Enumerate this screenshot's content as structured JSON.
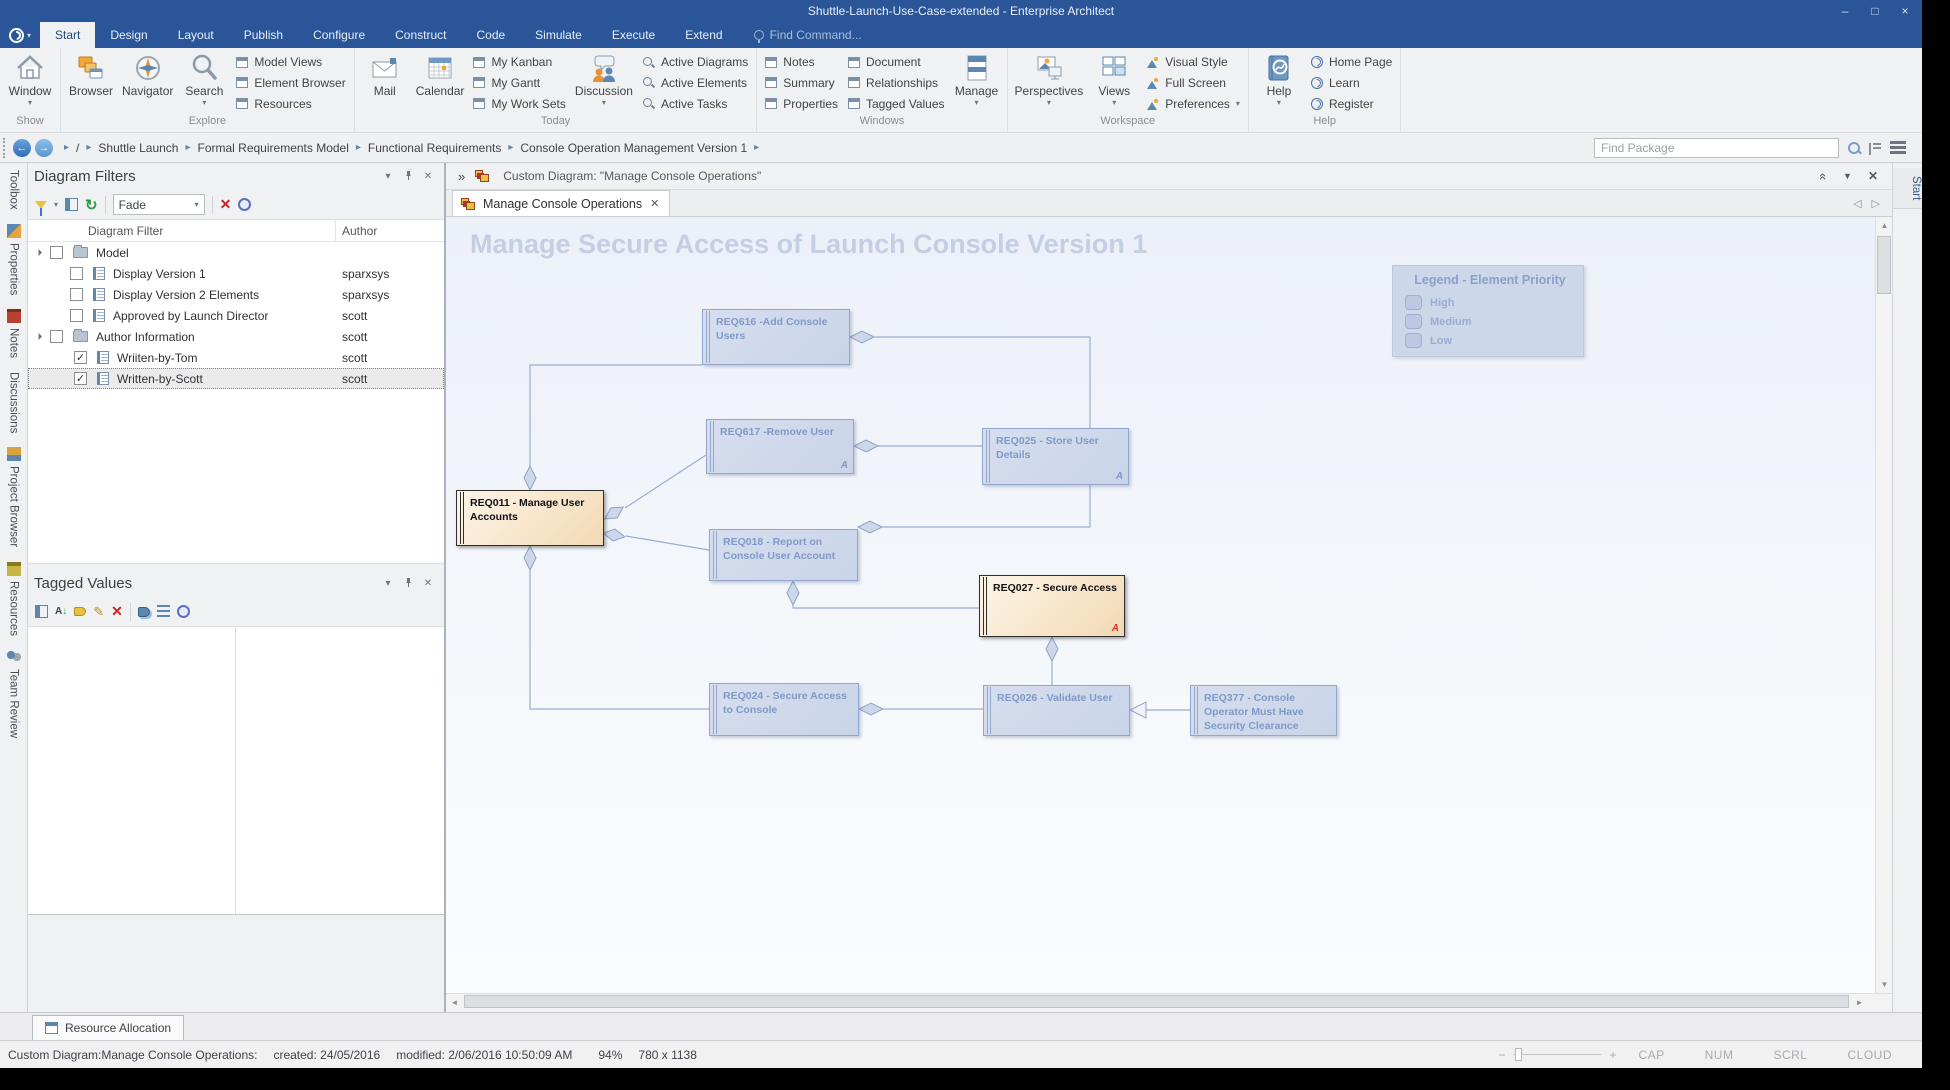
{
  "titlebar": {
    "title": "Shuttle-Launch-Use-Case-extended - Enterprise Architect"
  },
  "menu": {
    "tabs": [
      "Start",
      "Design",
      "Layout",
      "Publish",
      "Configure",
      "Construct",
      "Code",
      "Simulate",
      "Execute",
      "Extend"
    ],
    "find_command": "Find Command..."
  },
  "ribbon": {
    "window": "Window",
    "group_show": "Show",
    "browser": "Browser",
    "navigator": "Navigator",
    "search": "Search",
    "model_views": "Model Views",
    "element_browser": "Element Browser",
    "resources": "Resources",
    "group_explore": "Explore",
    "mail": "Mail",
    "calendar": "Calendar",
    "my_kanban": "My Kanban",
    "my_gantt": "My Gantt",
    "my_work_sets": "My Work Sets",
    "discussion": "Discussion",
    "active_diagrams": "Active Diagrams",
    "active_elements": "Active Elements",
    "active_tasks": "Active Tasks",
    "group_today": "Today",
    "notes": "Notes",
    "summary": "Summary",
    "properties": "Properties",
    "document": "Document",
    "relationships": "Relationships",
    "tagged_values": "Tagged Values",
    "manage": "Manage",
    "group_windows": "Windows",
    "perspectives": "Perspectives",
    "views": "Views",
    "visual_style": "Visual Style",
    "full_screen": "Full Screen",
    "preferences": "Preferences",
    "group_workspace": "Workspace",
    "help": "Help",
    "home_page": "Home Page",
    "learn": "Learn",
    "register": "Register",
    "group_help": "Help"
  },
  "breadcrumb": {
    "root": "/",
    "items": [
      "Shuttle Launch",
      "Formal Requirements Model",
      "Functional Requirements",
      "Console Operation Management Version 1"
    ],
    "find_package": "Find Package"
  },
  "left_tabs": [
    "Toolbox",
    "Properties",
    "Notes",
    "Discussions",
    "Project Browser",
    "Resources",
    "Team Review"
  ],
  "right_tab": "Start",
  "filters": {
    "title": "Diagram Filters",
    "combo_value": "Fade",
    "columns": {
      "filter": "Diagram Filter",
      "author": "Author"
    },
    "rows": [
      {
        "label": "Model",
        "author": ""
      },
      {
        "label": "Display Version 1",
        "author": "sparxsys"
      },
      {
        "label": "Display Version 2 Elements",
        "author": "sparxsys"
      },
      {
        "label": "Approved by Launch Director",
        "author": "scott"
      },
      {
        "label": "Author Information",
        "author": "scott"
      },
      {
        "label": "Wriiten-by-Tom",
        "author": "scott"
      },
      {
        "label": "Written-by-Scott",
        "author": "scott"
      }
    ]
  },
  "tagged": {
    "title": "Tagged Values"
  },
  "bottom_tab": "Resource Allocation",
  "diagram": {
    "header": "Custom Diagram: \"Manage Console Operations\"",
    "tab": "Manage Console Operations",
    "watermark": "Manage Secure Access of Launch Console Version 1",
    "boxes": [
      {
        "id": "REQ616",
        "label": "REQ616 -Add Console Users",
        "marker": ""
      },
      {
        "id": "REQ617",
        "label": "REQ617 -Remove User",
        "marker": "A"
      },
      {
        "id": "REQ025",
        "label": "REQ025 - Store User Details",
        "marker": "A"
      },
      {
        "id": "REQ011",
        "label": "REQ011 - Manage User Accounts",
        "marker": ""
      },
      {
        "id": "REQ018",
        "label": "REQ018 - Report on Console User Account",
        "marker": ""
      },
      {
        "id": "REQ027",
        "label": "REQ027 - Secure Access",
        "marker": "A"
      },
      {
        "id": "REQ024",
        "label": "REQ024 - Secure Access to Console",
        "marker": ""
      },
      {
        "id": "REQ026",
        "label": "REQ026 - Validate User",
        "marker": ""
      },
      {
        "id": "REQ377",
        "label": "REQ377 - Console Operator Must Have Security Clearance",
        "marker": ""
      }
    ],
    "legend": {
      "title": "Legend - Element Priority",
      "items": [
        "High",
        "Medium",
        "Low"
      ]
    }
  },
  "statusbar": {
    "item1": "Custom Diagram:Manage Console Operations:",
    "item2": "created: 24/05/2016",
    "item3": "modified: 2/06/2016 10:50:09 AM",
    "zoom": "94%",
    "size": "780 x 1138",
    "indicators": [
      "CAP",
      "NUM",
      "SCRL",
      "CLOUD"
    ]
  },
  "colors": {
    "titlebar_blue": "#2a5699",
    "faded_fill": "#ccd7ea",
    "faded_border": "#93a7cd",
    "faded_text": "#8199c7",
    "highlight_fill": "#f6e3c8",
    "marker_red": "#e03030",
    "connector": "#9aadd0"
  }
}
